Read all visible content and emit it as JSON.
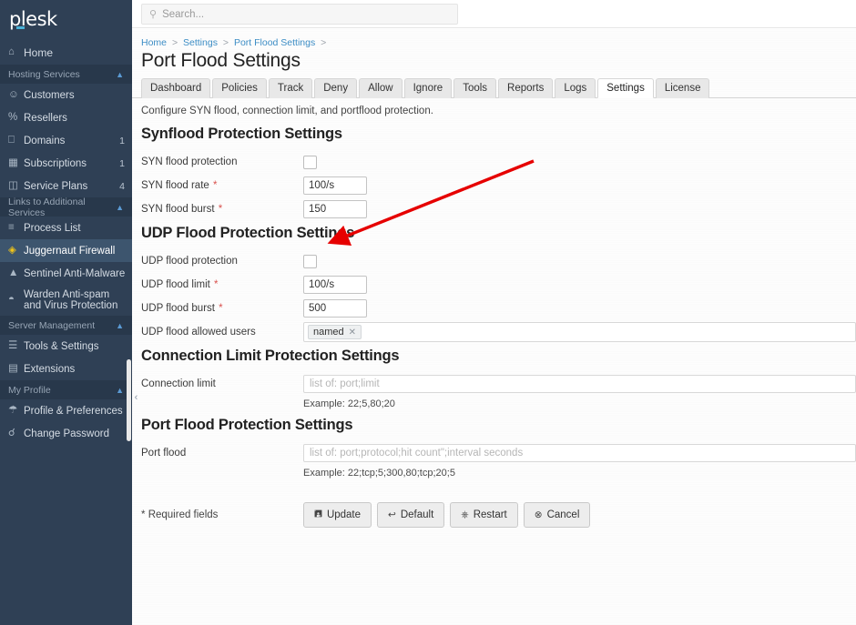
{
  "brand": {
    "name": "plesk",
    "accent": "#4bb3d8"
  },
  "search": {
    "placeholder": "Search...",
    "value": "",
    "icon": "search-icon"
  },
  "sidebar": {
    "home": {
      "label": "Home",
      "icon": "home-icon"
    },
    "sections": [
      {
        "title": "Hosting Services",
        "items": [
          {
            "label": "Customers",
            "icon": "user-icon",
            "badge": ""
          },
          {
            "label": "Resellers",
            "icon": "percent-icon",
            "badge": ""
          },
          {
            "label": "Domains",
            "icon": "monitor-icon",
            "badge": "1"
          },
          {
            "label": "Subscriptions",
            "icon": "grid-icon",
            "badge": "1"
          },
          {
            "label": "Service Plans",
            "icon": "book-icon",
            "badge": "4"
          }
        ]
      },
      {
        "title": "Links to Additional Services",
        "items": [
          {
            "label": "Process List",
            "icon": "list-icon",
            "badge": ""
          },
          {
            "label": "Juggernaut Firewall",
            "icon": "shield-icon",
            "badge": "",
            "active": true
          },
          {
            "label": "Sentinel Anti-Malware",
            "icon": "warning-icon",
            "badge": ""
          },
          {
            "label": "Warden Anti-spam and Virus Protection",
            "icon": "shield-check-icon",
            "badge": ""
          }
        ]
      },
      {
        "title": "Server Management",
        "items": [
          {
            "label": "Tools & Settings",
            "icon": "sliders-icon",
            "badge": ""
          },
          {
            "label": "Extensions",
            "icon": "puzzle-icon",
            "badge": ""
          }
        ]
      },
      {
        "title": "My Profile",
        "items": [
          {
            "label": "Profile & Preferences",
            "icon": "id-card-icon",
            "badge": ""
          },
          {
            "label": "Change Password",
            "icon": "key-icon",
            "badge": ""
          }
        ]
      }
    ]
  },
  "breadcrumb": {
    "items": [
      "Home",
      "Settings",
      "Port Flood Settings"
    ],
    "separator": ">"
  },
  "page": {
    "title": "Port Flood Settings"
  },
  "tabs": [
    {
      "label": "Dashboard",
      "active": false
    },
    {
      "label": "Policies",
      "active": false
    },
    {
      "label": "Track",
      "active": false
    },
    {
      "label": "Deny",
      "active": false
    },
    {
      "label": "Allow",
      "active": false
    },
    {
      "label": "Ignore",
      "active": false
    },
    {
      "label": "Tools",
      "active": false
    },
    {
      "label": "Reports",
      "active": false
    },
    {
      "label": "Logs",
      "active": false
    },
    {
      "label": "Settings",
      "active": true
    },
    {
      "label": "License",
      "active": false
    }
  ],
  "intro": "Configure SYN flood, connection limit, and portflood protection.",
  "synflood": {
    "title": "Synflood Protection Settings",
    "protection_label": "SYN flood protection",
    "protection_checked": false,
    "rate_label": "SYN flood rate",
    "rate_value": "100/s",
    "burst_label": "SYN flood burst",
    "burst_value": "150"
  },
  "udp": {
    "title": "UDP Flood Protection Settings",
    "protection_label": "UDP flood protection",
    "protection_checked": false,
    "limit_label": "UDP flood limit",
    "limit_value": "100/s",
    "burst_label": "UDP flood burst",
    "burst_value": "500",
    "allowed_users_label": "UDP flood allowed users",
    "allowed_users_tags": [
      "named"
    ]
  },
  "connlimit": {
    "title": "Connection Limit Protection Settings",
    "label": "Connection limit",
    "value": "",
    "placeholder": "list of: port;limit",
    "example": "Example: 22;5,80;20"
  },
  "portflood": {
    "title": "Port Flood Protection Settings",
    "label": "Port flood",
    "value": "",
    "placeholder": "list of: port;protocol;hit count\";interval seconds",
    "example": "Example: 22;tcp;5;300,80;tcp;20;5"
  },
  "footer": {
    "required_marker": "*",
    "required_text": "Required fields",
    "buttons": [
      {
        "label": "Update",
        "icon": "save-icon"
      },
      {
        "label": "Default",
        "icon": "undo-icon"
      },
      {
        "label": "Restart",
        "icon": "power-icon"
      },
      {
        "label": "Cancel",
        "icon": "cancel-icon"
      }
    ]
  },
  "annotation": {
    "type": "arrow",
    "color": "#e60000",
    "points_to": "udp-flood-protection-checkbox"
  }
}
